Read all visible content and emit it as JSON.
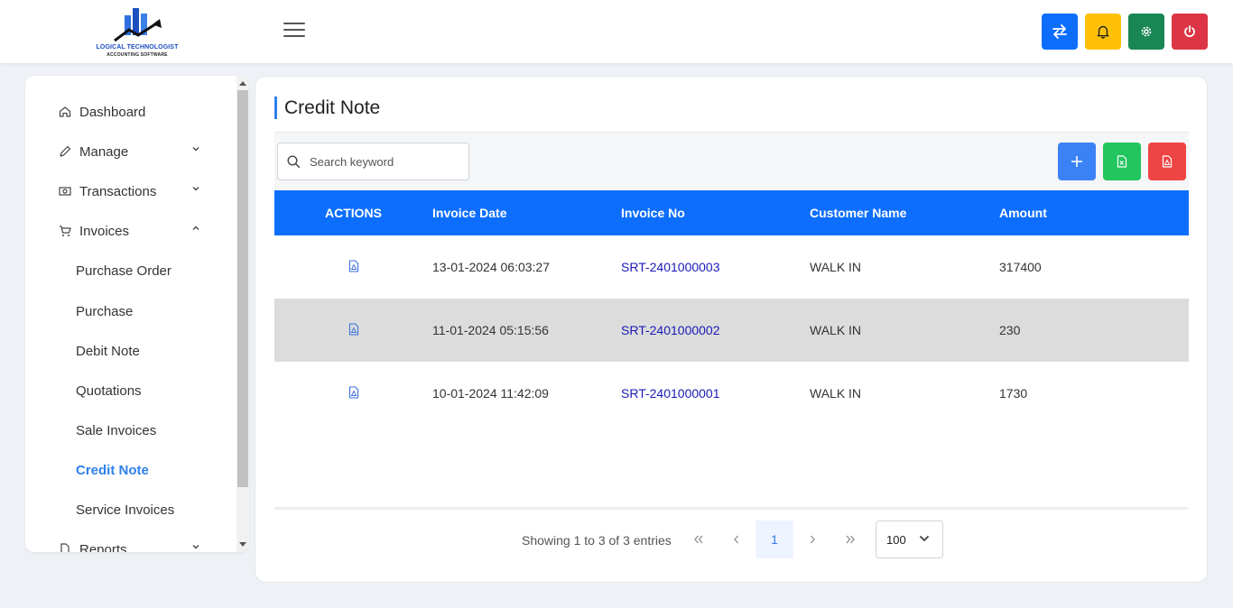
{
  "brand": {
    "title": "LOGICAL TECHNOLOGIST",
    "subtitle": "ACCOUNTING SOFTWARE"
  },
  "header_buttons": [
    {
      "icon": "switch-arrows-icon",
      "color": "#0d6efd"
    },
    {
      "icon": "bell-icon",
      "color": "#ffc107"
    },
    {
      "icon": "gear-icon",
      "color": "#198754"
    },
    {
      "icon": "power-icon",
      "color": "#dc3545"
    }
  ],
  "sidebar": {
    "items": [
      {
        "label": "Dashboard",
        "icon": "home-icon"
      },
      {
        "label": "Manage",
        "icon": "pencil-icon"
      },
      {
        "label": "Transactions",
        "icon": "money-icon"
      },
      {
        "label": "Invoices",
        "icon": "cart-icon"
      },
      {
        "label": "Reports",
        "icon": "report-icon"
      }
    ],
    "invoice_subitems": [
      "Purchase Order",
      "Purchase",
      "Debit Note",
      "Quotations",
      "Sale Invoices",
      "Credit Note",
      "Service Invoices"
    ],
    "active": "Credit Note"
  },
  "page": {
    "title": "Credit Note"
  },
  "search": {
    "placeholder": "Search keyword"
  },
  "toolbar_buttons": [
    {
      "icon": "plus-icon",
      "color": "#3b82f6"
    },
    {
      "icon": "excel-file-icon",
      "color": "#22c55e"
    },
    {
      "icon": "pdf-file-icon",
      "color": "#ef4444"
    }
  ],
  "table": {
    "headers": [
      "ACTIONS",
      "Invoice Date",
      "Invoice No",
      "Customer Name",
      "Amount"
    ],
    "rows": [
      {
        "date": "13-01-2024 06:03:27",
        "invoice_no": "SRT-2401000003",
        "customer": "WALK IN",
        "amount": "317400"
      },
      {
        "date": "11-01-2024 05:15:56",
        "invoice_no": "SRT-2401000002",
        "customer": "WALK IN",
        "amount": "230"
      },
      {
        "date": "10-01-2024 11:42:09",
        "invoice_no": "SRT-2401000001",
        "customer": "WALK IN",
        "amount": "1730"
      }
    ]
  },
  "pagination": {
    "showing": "Showing 1 to 3 of 3 entries",
    "current_page": "1",
    "page_size": "100"
  }
}
